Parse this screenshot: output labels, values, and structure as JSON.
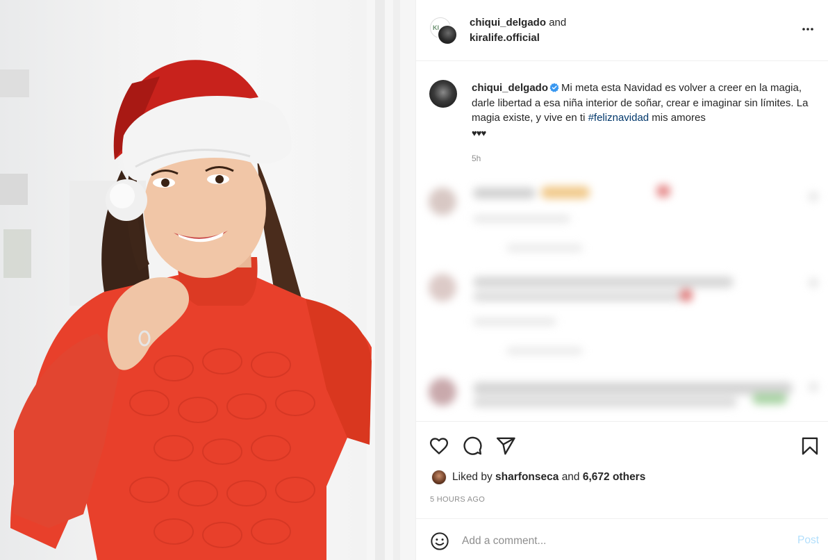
{
  "post": {
    "image_alt": "Woman in a Santa hat and red knit turtleneck smiling"
  },
  "header": {
    "user1": "chiqui_delgado",
    "and_text": "and",
    "user2": "kiralife.official",
    "collab_avatar_text": "KL",
    "more_icon": "more-horizontal-icon"
  },
  "caption": {
    "username": "chiqui_delgado",
    "text_before_tag": "Mi meta esta Navidad es volver a creer en la magia, darle libertad a esa niña interior de soñar, crear e imaginar sin límites. La magia existe, y vive en ti ",
    "hashtag": "#feliznavidad",
    "text_after_tag": " mis amores",
    "hearts": "♥♥♥",
    "time": "5h"
  },
  "actions": {
    "like_icon": "heart-icon",
    "comment_icon": "comment-icon",
    "share_icon": "send-icon",
    "save_icon": "bookmark-icon"
  },
  "likes": {
    "prefix": "Liked by",
    "user": "sharfonseca",
    "middle": "and",
    "others": "6,672 others"
  },
  "timestamp": "5 HOURS AGO",
  "comment_box": {
    "placeholder": "Add a comment...",
    "post_label": "Post",
    "emoji_icon": "smiley-icon"
  },
  "colors": {
    "link": "#00376b",
    "verified": "#3897f0",
    "post_button_disabled": "#b2dffc",
    "secondary_text": "#8e8e8e",
    "sweater_red": "#e8402b",
    "hat_red": "#c8221c"
  }
}
